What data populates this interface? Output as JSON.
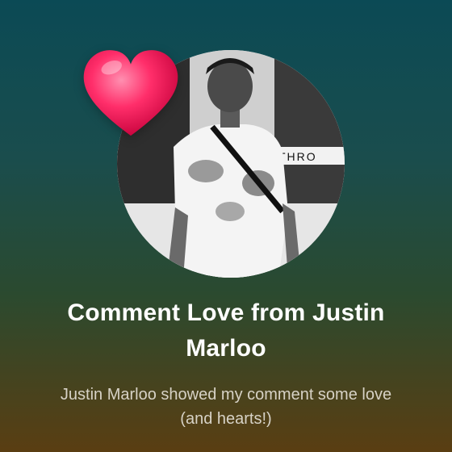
{
  "card": {
    "title": "Comment Love from Justin Marloo",
    "subtitle": "Justin Marloo showed my comment some love (and hearts!)",
    "avatar": {
      "person": "Justin Marloo",
      "sign_text": "THRO"
    },
    "heart_icon": {
      "color": "#ff2e6a"
    }
  }
}
